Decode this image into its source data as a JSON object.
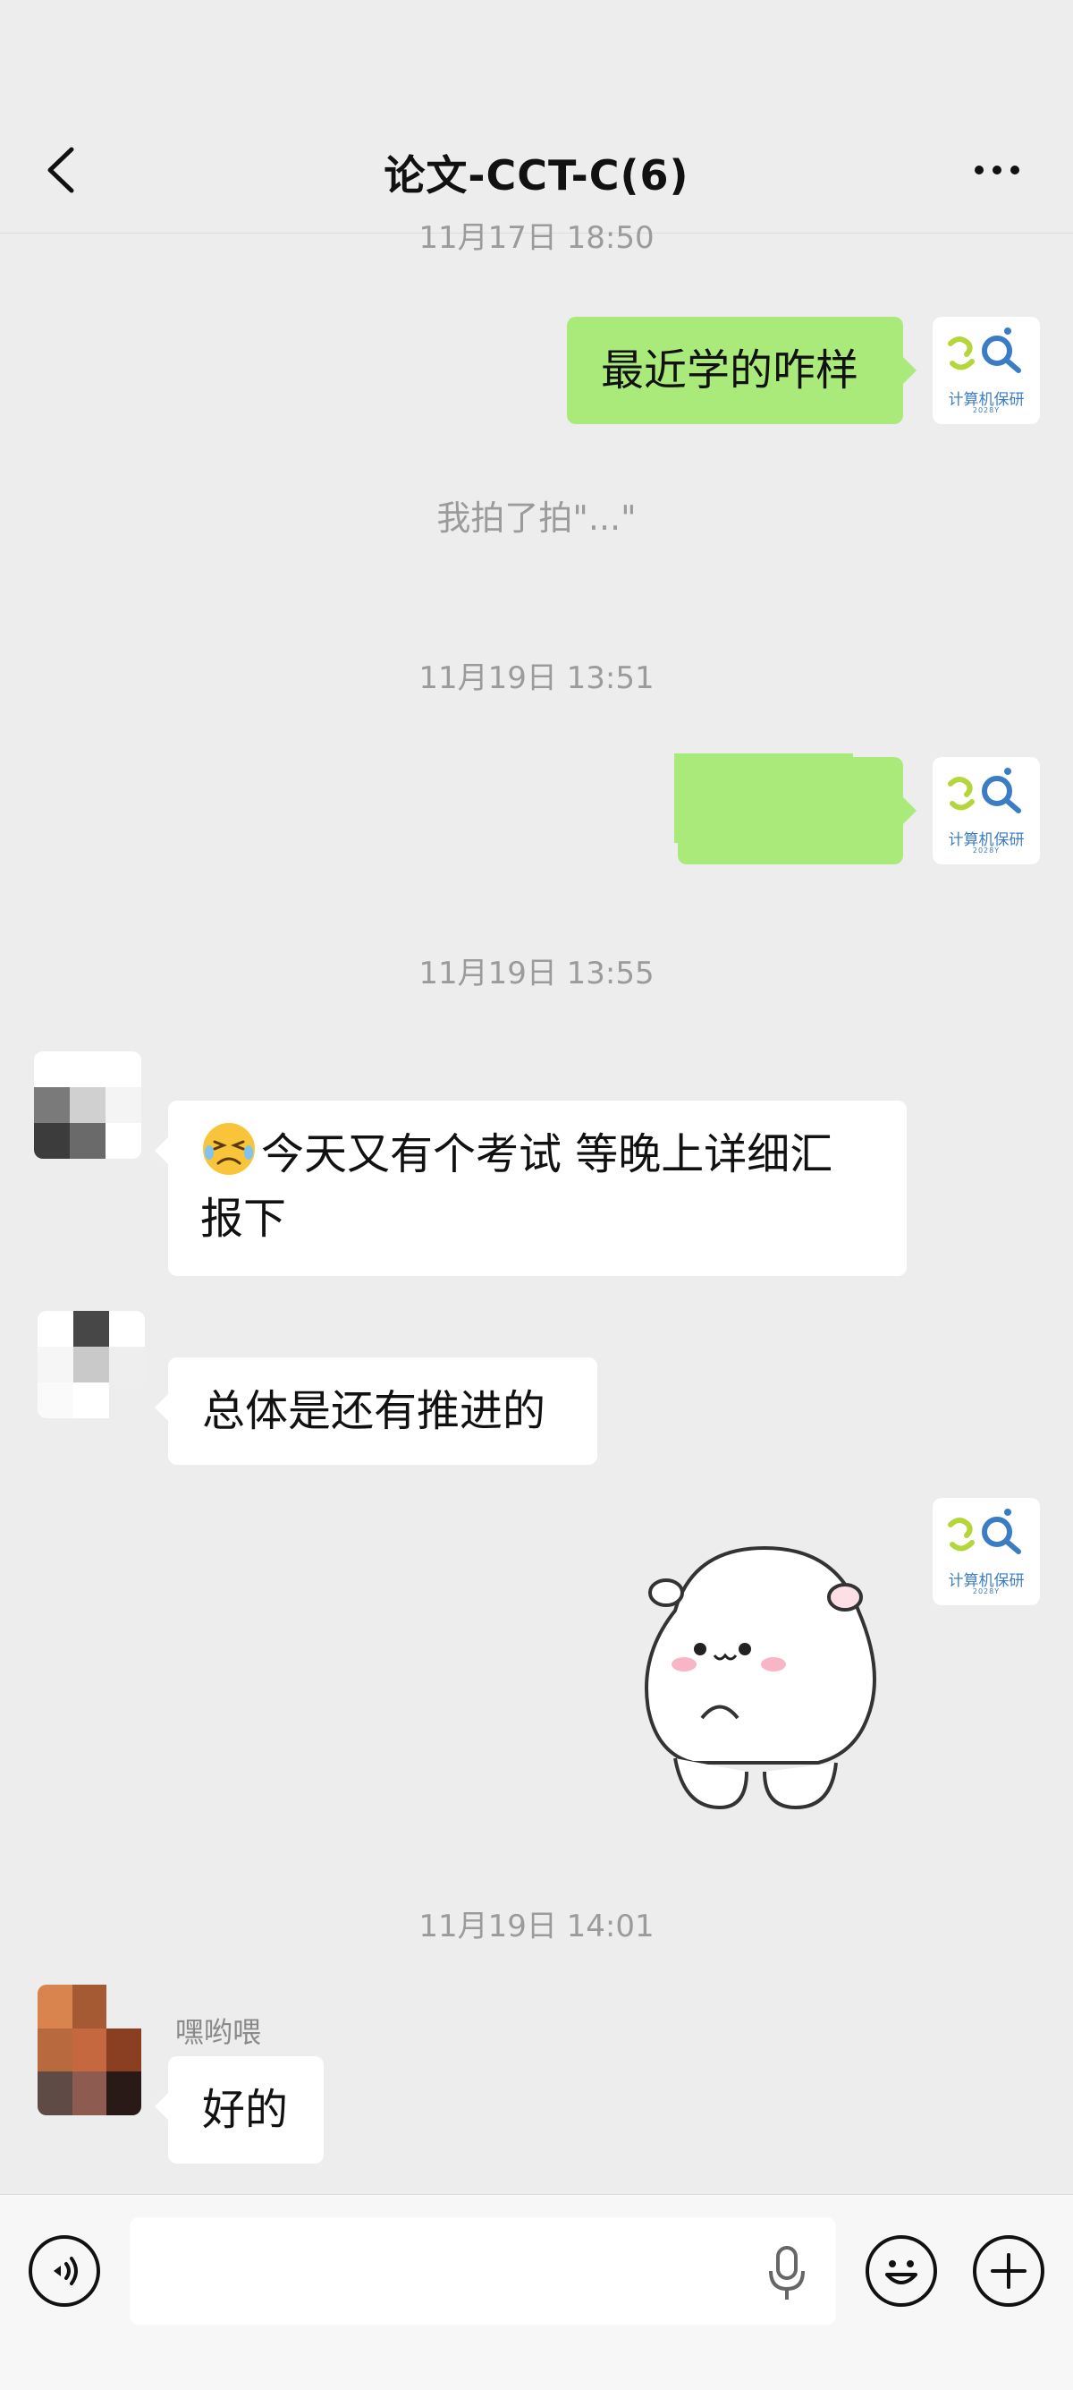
{
  "header": {
    "title": "论文-CCT-C(6)",
    "back_icon": "chevron-left-icon",
    "more_icon": "more-horizontal-icon"
  },
  "messages": {
    "top_timestamp_partial": "11月17日 18:50",
    "msg1_text": "最近学的咋样",
    "system_partial": "我拍了拍\"...\"",
    "timestamp2": "11月19日 13:51",
    "timestamp3": "11月19日 13:55",
    "msg3_text": "今天又有个考试 等晚上详细汇报下",
    "msg3_emoji": "persevering-face-emoji",
    "msg4_text": "总体是还有推进的",
    "sticker": "white-hamster-sticker",
    "timestamp4": "11月19日 14:01",
    "sender_name": "嘿哟喂",
    "msg6_text": "好的"
  },
  "my_avatar": {
    "logo_text": "计算机保研",
    "logo_sub": "2028Y"
  },
  "input_bar": {
    "voice_icon": "voice-mode-icon",
    "mic_icon": "microphone-icon",
    "emoji_icon": "smiley-icon",
    "plus_icon": "plus-icon",
    "input_value": ""
  },
  "colors": {
    "background": "#ededed",
    "my_bubble": "#a9ea7a",
    "other_bubble": "#ffffff",
    "timestamp": "#9b9b9b",
    "logo_blue": "#3b7dc4",
    "logo_green": "#b5d63a"
  }
}
